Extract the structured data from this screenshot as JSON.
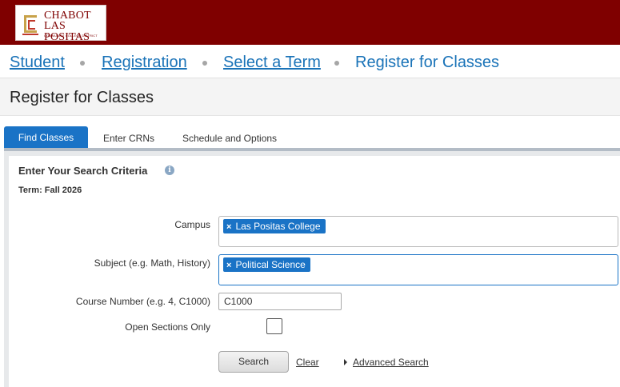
{
  "brand": {
    "line1": "CHABOT",
    "line2": "LAS POSITAS",
    "line3": "COMMUNITY COLLEGE DISTRICT",
    "color": "#7f0000",
    "icon": "college-logo-icon"
  },
  "breadcrumb": {
    "items": [
      {
        "label": "Student"
      },
      {
        "label": "Registration"
      },
      {
        "label": "Select a Term"
      },
      {
        "label": "Register for Classes"
      }
    ]
  },
  "page": {
    "title": "Register for Classes"
  },
  "tabs": [
    {
      "label": "Find Classes",
      "active": true
    },
    {
      "label": "Enter CRNs",
      "active": false
    },
    {
      "label": "Schedule and Options",
      "active": false
    }
  ],
  "search": {
    "title": "Enter Your Search Criteria",
    "info_icon": "info-icon",
    "term": "Term: Fall 2026",
    "campus": {
      "label": "Campus",
      "selected": "Las Positas College"
    },
    "subject": {
      "label": "Subject (e.g. Math, History)",
      "selected": "Political Science"
    },
    "course_number": {
      "label": "Course Number (e.g. 4, C1000)",
      "value": "C1000"
    },
    "open_sections": {
      "label": "Open Sections Only",
      "checked": false
    },
    "search_label": "Search",
    "clear_label": "Clear",
    "advanced_label": "Advanced Search",
    "chip_remove": "×"
  },
  "colors": {
    "accent": "#1a73c6",
    "link": "#1a73b8"
  }
}
